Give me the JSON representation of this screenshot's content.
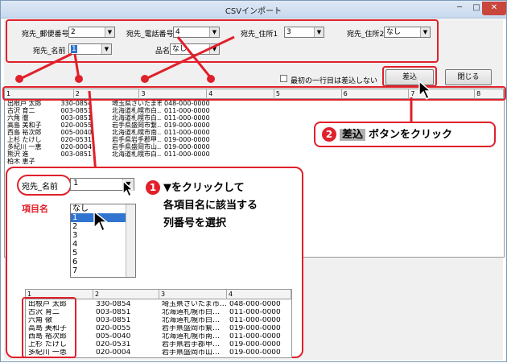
{
  "window": {
    "title": "CSVインポート",
    "min": "─",
    "max": "□",
    "close": "✕"
  },
  "fields": [
    {
      "label": "宛先_郵便番号",
      "value": "2"
    },
    {
      "label": "宛先_電話番号",
      "value": "4"
    },
    {
      "label": "宛先_住所1",
      "value": "3"
    },
    {
      "label": "宛先_住所2",
      "value": "なし"
    },
    {
      "label": "宛先_名前",
      "value": "1"
    },
    {
      "label": "品名",
      "value": "なし"
    }
  ],
  "checkbox_label": "最初の一行目は差込しない",
  "buttons": {
    "insert": "差込",
    "close": "閉じる"
  },
  "grid": {
    "headers": [
      "1",
      "2",
      "3",
      "4",
      "5",
      "6",
      "7",
      "8"
    ],
    "rows": [
      [
        "出根戸 太郎",
        "330-0854",
        "埼玉県さいたま市…",
        "048-000-0000"
      ],
      [
        "古沢 育二",
        "003-0851",
        "北海道札幌市白…",
        "011-000-0000"
      ],
      [
        "六角 徹",
        "003-0851",
        "北海道札幌市白…",
        "011-000-0000"
      ],
      [
        "高島 美和子",
        "020-0055",
        "岩手県盛岡市繋…",
        "019-000-0000"
      ],
      [
        "西島 裕次郎",
        "005-0040",
        "北海道札幌市南…",
        "011-000-0000"
      ],
      [
        "上杉 たけし",
        "020-0531",
        "岩手県岩手郡甲…",
        "019-000-0000"
      ],
      [
        "多紀川 一恵",
        "020-0004",
        "岩手県盛岡市山…",
        "019-000-0000"
      ],
      [
        "熊沢 進",
        "003-0851",
        "北海道札幌市白…",
        "011-000-0000"
      ],
      [
        "柏木 恵子",
        "",
        "",
        ""
      ]
    ]
  },
  "callout2": {
    "num": "2",
    "tag": "差込",
    "text": "ボタンをクリック"
  },
  "callout1": {
    "field_label": "宛先_名前",
    "value": "1",
    "tag_label": "項目名",
    "num": "1",
    "line1": "▼をクリックして",
    "line2": "各項目名に該当する",
    "line3": "列番号を選択",
    "options": [
      "なし",
      "1",
      "2",
      "3",
      "4",
      "5",
      "6",
      "7"
    ],
    "mini_headers": [
      "1",
      "2",
      "3",
      "4"
    ],
    "mini_rows": [
      [
        "出根戸 太郎",
        "330-0854",
        "埼玉県さいたま市…",
        "048-000-0000"
      ],
      [
        "古沢 育二",
        "003-0851",
        "北海道札幌市白…",
        "011-000-0000"
      ],
      [
        "六角 徹",
        "003-0851",
        "北海道札幌市白…",
        "011-000-0000"
      ],
      [
        "高島 美和子",
        "020-0055",
        "岩手県盛岡市繋…",
        "019-000-0000"
      ],
      [
        "西島 裕次郎",
        "005-0040",
        "北海道札幌市南…",
        "011-000-0000"
      ],
      [
        "上杉 たけし",
        "020-0531",
        "岩手県岩手郡甲…",
        "019-000-0000"
      ],
      [
        "多紀川 一恵",
        "020-0004",
        "岩手県盛岡市山…",
        "019-000-0000"
      ]
    ]
  },
  "colors": {
    "accent": "#e0202a",
    "selection": "#3074d0"
  }
}
